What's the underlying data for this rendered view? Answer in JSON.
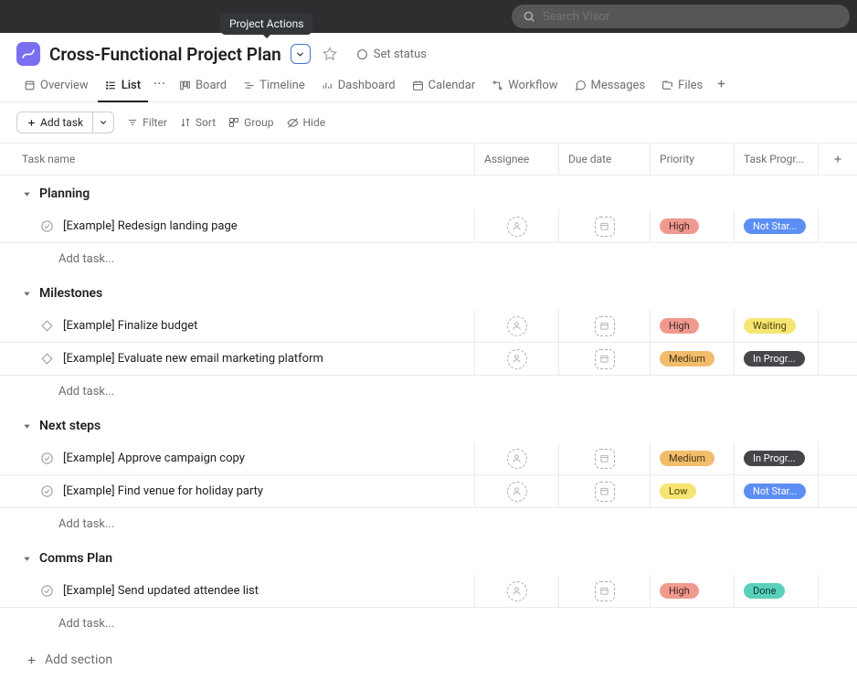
{
  "tooltip": "Project Actions",
  "search": {
    "placeholder": "Search Visor"
  },
  "project": {
    "title": "Cross-Functional Project Plan",
    "set_status": "Set status"
  },
  "tabs": [
    {
      "id": "overview",
      "label": "Overview"
    },
    {
      "id": "list",
      "label": "List"
    },
    {
      "id": "board",
      "label": "Board"
    },
    {
      "id": "timeline",
      "label": "Timeline"
    },
    {
      "id": "dashboard",
      "label": "Dashboard"
    },
    {
      "id": "calendar",
      "label": "Calendar"
    },
    {
      "id": "workflow",
      "label": "Workflow"
    },
    {
      "id": "messages",
      "label": "Messages"
    },
    {
      "id": "files",
      "label": "Files"
    }
  ],
  "toolbar": {
    "add_task": "Add task",
    "filter": "Filter",
    "sort": "Sort",
    "group": "Group",
    "hide": "Hide"
  },
  "columns": {
    "name": "Task name",
    "assignee": "Assignee",
    "due": "Due date",
    "priority": "Priority",
    "progress": "Task Progr..."
  },
  "sections": [
    {
      "title": "Planning",
      "tasks": [
        {
          "name": "[Example] Redesign landing page",
          "type": "task",
          "priority": "High",
          "priority_class": "pill-high",
          "progress": "Not Star...",
          "progress_class": "pill-notstarted"
        }
      ]
    },
    {
      "title": "Milestones",
      "tasks": [
        {
          "name": "[Example] Finalize budget",
          "type": "milestone",
          "priority": "High",
          "priority_class": "pill-high",
          "progress": "Waiting",
          "progress_class": "pill-waiting"
        },
        {
          "name": "[Example] Evaluate new email marketing platform",
          "type": "milestone",
          "priority": "Medium",
          "priority_class": "pill-medium",
          "progress": "In Progr...",
          "progress_class": "pill-inprogress"
        }
      ]
    },
    {
      "title": "Next steps",
      "tasks": [
        {
          "name": "[Example] Approve campaign copy",
          "type": "task",
          "priority": "Medium",
          "priority_class": "pill-medium",
          "progress": "In Progr...",
          "progress_class": "pill-inprogress"
        },
        {
          "name": "[Example] Find venue for holiday party",
          "type": "task",
          "priority": "Low",
          "priority_class": "pill-low",
          "progress": "Not Star...",
          "progress_class": "pill-notstarted"
        }
      ]
    },
    {
      "title": "Comms Plan",
      "tasks": [
        {
          "name": "[Example] Send updated attendee list",
          "type": "task",
          "priority": "High",
          "priority_class": "pill-high",
          "progress": "Done",
          "progress_class": "pill-done"
        }
      ]
    }
  ],
  "row_add_task": "Add task...",
  "add_section": "Add section"
}
